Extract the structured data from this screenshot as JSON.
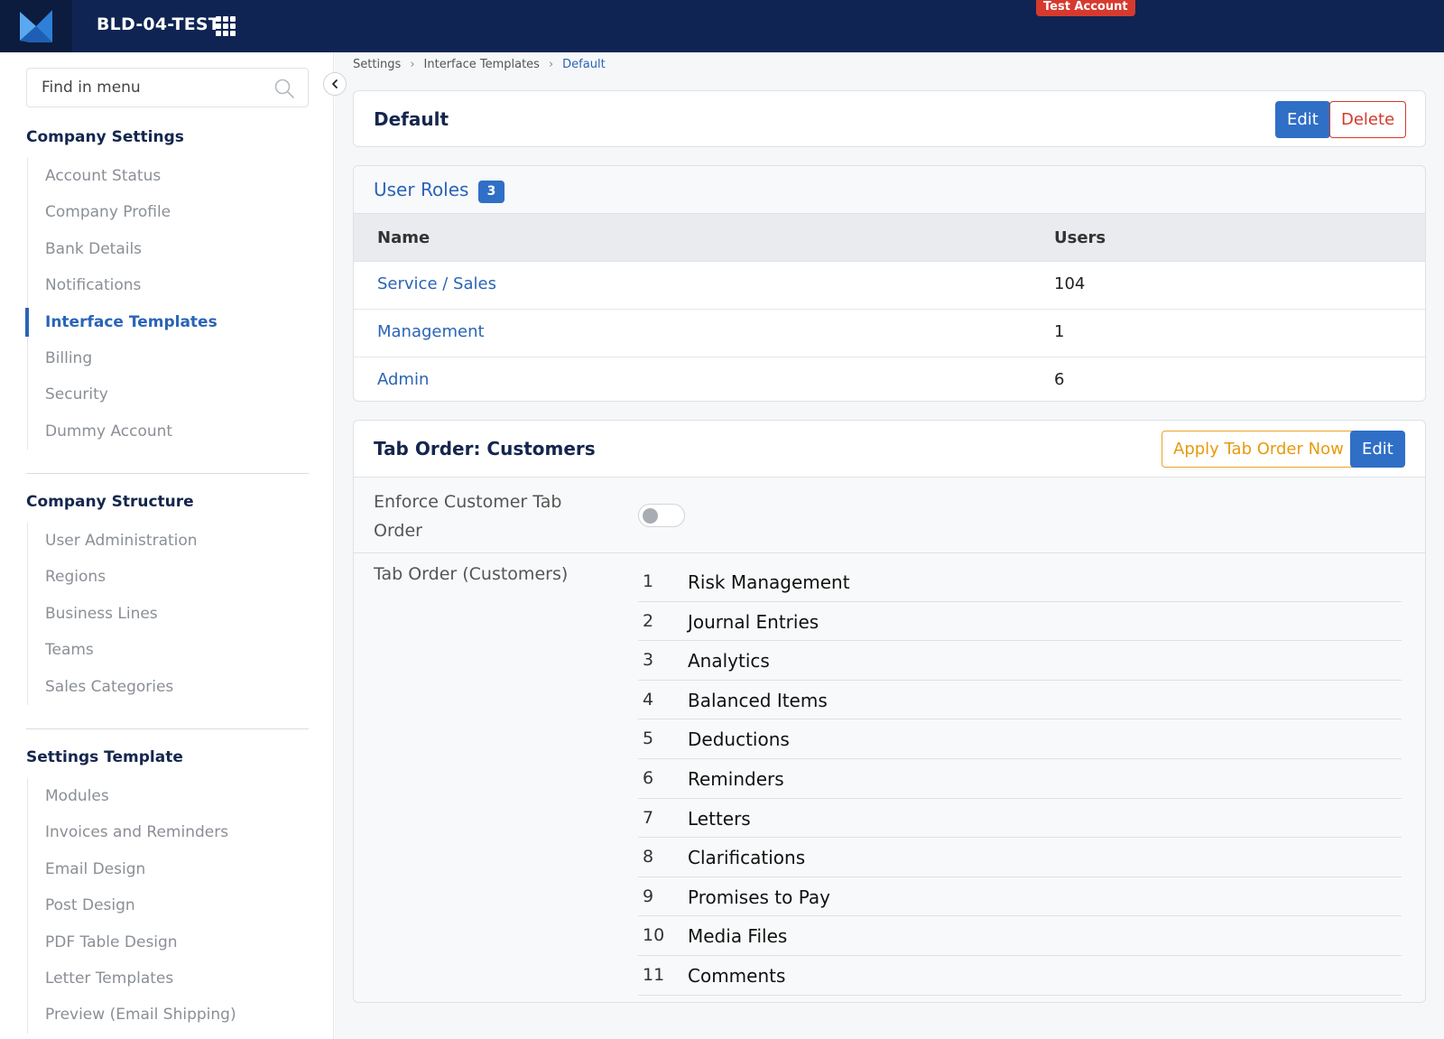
{
  "header": {
    "app_title": "BLD-04-TEST",
    "account_badge": "Test Account",
    "colors": {
      "bar": "#0f2452",
      "badge": "#d63a2f"
    }
  },
  "sidebar": {
    "search_placeholder": "Find in menu",
    "sections": [
      {
        "title": "Company Settings",
        "items": [
          "Account Status",
          "Company Profile",
          "Bank Details",
          "Notifications",
          "Interface Templates",
          "Billing",
          "Security",
          "Dummy Account"
        ],
        "active_index": 4
      },
      {
        "title": "Company Structure",
        "items": [
          "User Administration",
          "Regions",
          "Business Lines",
          "Teams",
          "Sales Categories"
        ]
      },
      {
        "title": "Settings Template",
        "items": [
          "Modules",
          "Invoices and Reminders",
          "Email Design",
          "Post Design",
          "PDF Table Design",
          "Letter Templates",
          "Preview (Email Shipping)"
        ]
      }
    ]
  },
  "breadcrumb": [
    "Settings",
    "Interface Templates",
    "Default"
  ],
  "template_card": {
    "title": "Default",
    "edit_label": "Edit",
    "delete_label": "Delete"
  },
  "user_roles": {
    "title": "User Roles",
    "count": "3",
    "columns": [
      "Name",
      "Users"
    ],
    "rows": [
      {
        "name": "Service / Sales",
        "users": "104"
      },
      {
        "name": "Management",
        "users": "1"
      },
      {
        "name": "Admin",
        "users": "6"
      }
    ]
  },
  "tab_order": {
    "title": "Tab Order: Customers",
    "apply_label": "Apply Tab Order Now",
    "edit_label": "Edit",
    "enforce_label": "Enforce Customer Tab Order",
    "enforce_enabled": false,
    "list_label": "Tab Order (Customers)",
    "items": [
      {
        "num": "1",
        "name": "Risk Management"
      },
      {
        "num": "2",
        "name": "Journal Entries"
      },
      {
        "num": "3",
        "name": "Analytics"
      },
      {
        "num": "4",
        "name": "Balanced Items"
      },
      {
        "num": "5",
        "name": "Deductions"
      },
      {
        "num": "6",
        "name": "Reminders"
      },
      {
        "num": "7",
        "name": "Letters"
      },
      {
        "num": "8",
        "name": "Clarifications"
      },
      {
        "num": "9",
        "name": "Promises to Pay"
      },
      {
        "num": "10",
        "name": "Media Files"
      },
      {
        "num": "11",
        "name": "Comments"
      }
    ]
  }
}
